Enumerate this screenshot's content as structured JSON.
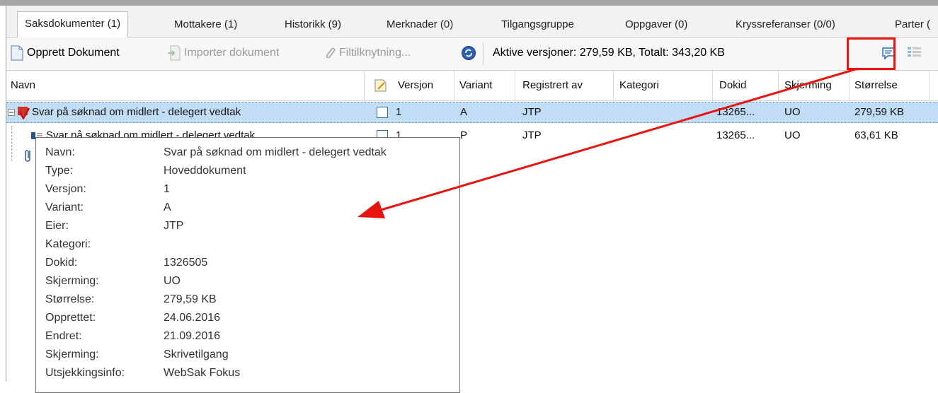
{
  "tabs": [
    {
      "label": "Saksdokumenter (1)",
      "active": true
    },
    {
      "label": "Mottakere (1)"
    },
    {
      "label": "Historikk (9)"
    },
    {
      "label": "Merknader (0)"
    },
    {
      "label": "Tilgangsgruppe"
    },
    {
      "label": "Oppgaver (0)"
    },
    {
      "label": "Kryssreferanser (0/0)"
    },
    {
      "label": "Parter ("
    }
  ],
  "toolbar": {
    "create_document": "Opprett Dokument",
    "import_document": "Importer dokument",
    "file_link": "Filtilknytning...",
    "status_text": "Aktive versjoner: 279,59 KB,  Totalt: 343,20 KB"
  },
  "columns": {
    "name": "Navn",
    "version": "Versjon",
    "variant": "Variant",
    "registered_by": "Registrert av",
    "category": "Kategori",
    "doc_id": "Dokid",
    "screening": "Skjerming",
    "size": "Størrelse"
  },
  "rows": [
    {
      "name": "Svar på søknad om midlert - delegert vedtak",
      "version": "1",
      "variant": "A",
      "registered_by": "JTP",
      "doc_id": "13265...",
      "screening": "UO",
      "size": "279,59 KB"
    },
    {
      "name": "Svar på søknad om midlert - delegert vedtak",
      "version": "1",
      "variant": "P",
      "registered_by": "JTP",
      "doc_id": "13265...",
      "screening": "UO",
      "size": "63,61 KB"
    }
  ],
  "tooltip": [
    {
      "label": "Navn:",
      "value": "Svar på søknad om midlert - delegert vedtak"
    },
    {
      "label": "Type:",
      "value": "Hoveddokument"
    },
    {
      "label": "Versjon:",
      "value": "1"
    },
    {
      "label": "Variant:",
      "value": "A"
    },
    {
      "label": "Eier:",
      "value": "JTP"
    },
    {
      "label": "Kategori:",
      "value": ""
    },
    {
      "label": "Dokid:",
      "value": "1326505"
    },
    {
      "label": "Skjerming:",
      "value": "UO"
    },
    {
      "label": "Størrelse:",
      "value": "279,59 KB"
    },
    {
      "label": "Opprettet:",
      "value": "24.06.2016"
    },
    {
      "label": "Endret:",
      "value": "21.09.2016"
    },
    {
      "label": "Skjerming:",
      "value": "Skrivetilgang"
    },
    {
      "label": "Utsjekkingsinfo:",
      "value": "WebSak Fokus"
    }
  ],
  "colors": {
    "annotation": "#e8140f",
    "selection": "#c1dcf5"
  }
}
